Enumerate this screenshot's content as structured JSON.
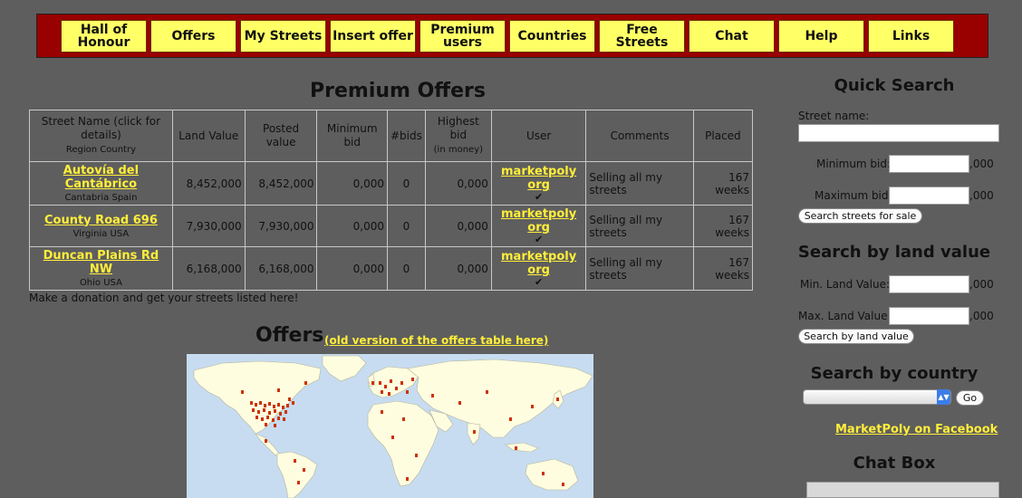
{
  "nav": {
    "items": [
      "Hall of Honour",
      "Offers",
      "My Streets",
      "Insert offer",
      "Premium users",
      "Countries",
      "Free Streets",
      "Chat",
      "Help",
      "Links"
    ]
  },
  "premium": {
    "title": "Premium Offers",
    "headers": {
      "street": "Street Name (click for details)",
      "region": "Region Country",
      "land": "Land Value",
      "posted": "Posted value",
      "minbid": "Minimum bid",
      "bids": "#bids",
      "highest": "Highest bid",
      "highest_sub": "(in money)",
      "user": "User",
      "comments": "Comments",
      "placed": "Placed"
    },
    "rows": [
      {
        "street": "Autovía del Cantábrico",
        "region": "Cantabria Spain",
        "land": "8,452,000",
        "posted": "8,452,000",
        "minbid": "0,000",
        "bids": "0",
        "highest": "0,000",
        "user": "marketpoly org",
        "check": "✔",
        "comments": "Selling all my streets",
        "placed": "167 weeks"
      },
      {
        "street": "County Road 696",
        "region": "Virginia USA",
        "land": "7,930,000",
        "posted": "7,930,000",
        "minbid": "0,000",
        "bids": "0",
        "highest": "0,000",
        "user": "marketpoly org",
        "check": "✔",
        "comments": "Selling all my streets",
        "placed": "167 weeks"
      },
      {
        "street": "Duncan Plains Rd NW",
        "region": "Ohio USA",
        "land": "6,168,000",
        "posted": "6,168,000",
        "minbid": "0,000",
        "bids": "0",
        "highest": "0,000",
        "user": "marketpoly org",
        "check": "✔",
        "comments": "Selling all my streets",
        "placed": "167 weeks"
      }
    ]
  },
  "donation_text": "Make a donation and get your streets listed here!",
  "offers": {
    "title": "Offers",
    "old_link": "(old version of the offers table here)"
  },
  "sidebar": {
    "quick_search_title": "Quick Search",
    "street_name_label": "Street name:",
    "min_bid_label": "Minimum bid:",
    "max_bid_label": "Maximum bid:",
    "suffix": ",000",
    "search_streets_button": "Search streets for sale",
    "land_value_title": "Search by land value",
    "min_land_label": "Min. Land Value:",
    "max_land_label": "Max. Land Value:",
    "search_land_button": "Search by land value",
    "country_title": "Search by country",
    "go_button": "Go",
    "facebook_link": "MarketPoly on Facebook",
    "chat_title": "Chat Box"
  },
  "colors": {
    "background": "#5e5e5e",
    "nav_bar": "#990000",
    "nav_button": "#ffff66",
    "link": "#ffee3a"
  }
}
